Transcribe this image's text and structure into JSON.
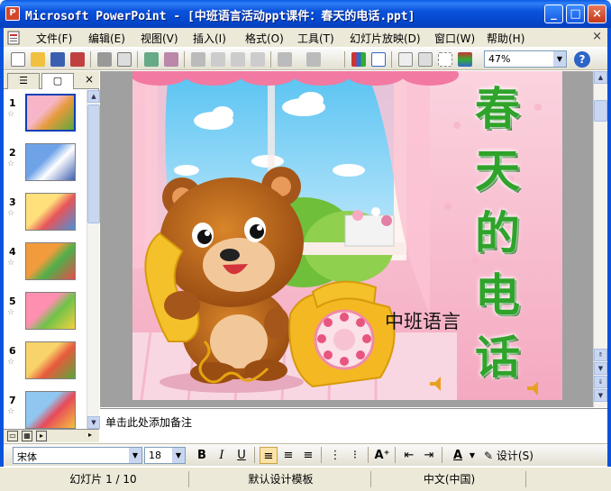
{
  "window": {
    "title": "Microsoft PowerPoint - [中班语言活动ppt课件：春天的电话.ppt]",
    "app_icon": "P"
  },
  "menu": {
    "items": [
      {
        "label": "文件(F)"
      },
      {
        "label": "编辑(E)"
      },
      {
        "label": "视图(V)"
      },
      {
        "label": "插入(I)"
      },
      {
        "label": "格式(O)"
      },
      {
        "label": "工具(T)"
      },
      {
        "label": "幻灯片放映(D)"
      },
      {
        "label": "窗口(W)"
      },
      {
        "label": "帮助(H)"
      }
    ],
    "doc_close": "×"
  },
  "toolbar": {
    "zoom": "47%",
    "help": "?"
  },
  "left_pane": {
    "tabs": [
      "☰",
      "▢"
    ],
    "close": "×",
    "slides": [
      {
        "number": "1",
        "selected": true,
        "palette": [
          "#f6b6c8",
          "#e69a3c",
          "#5aa83c"
        ]
      },
      {
        "number": "2",
        "selected": false,
        "palette": [
          "#6fa3e8",
          "#ffffff",
          "#3b5fb0"
        ]
      },
      {
        "number": "3",
        "selected": false,
        "palette": [
          "#ffe07a",
          "#e8565a",
          "#4a90d9"
        ]
      },
      {
        "number": "4",
        "selected": false,
        "palette": [
          "#f29b3c",
          "#4fb04a",
          "#e94b4b"
        ]
      },
      {
        "number": "5",
        "selected": false,
        "palette": [
          "#ff8fb0",
          "#6fc24a",
          "#f4d13c"
        ]
      },
      {
        "number": "6",
        "selected": false,
        "palette": [
          "#f7d36a",
          "#e85a3c",
          "#5aa83c"
        ]
      },
      {
        "number": "7",
        "selected": false,
        "palette": [
          "#8fc7f0",
          "#e84a5a",
          "#f2c23c"
        ]
      }
    ]
  },
  "slide": {
    "vertical_title": [
      "春",
      "天",
      "的",
      "电",
      "话"
    ],
    "subtitle": "中班语言"
  },
  "notes": {
    "placeholder": "单击此处添加备注"
  },
  "format_bar": {
    "font_name": "宋体",
    "font_size": "18",
    "bold": "B",
    "italic": "I",
    "underline": "U",
    "font_color_label": "A",
    "design_label": "设计(S)"
  },
  "status": {
    "slide_position": "幻灯片 1 / 10",
    "template": "默认设计模板",
    "language": "中文(中国)"
  },
  "colors": {
    "titlebar": "#0a52dc",
    "chrome": "#ece9d8",
    "slide_title_green": "#2fa32a"
  }
}
